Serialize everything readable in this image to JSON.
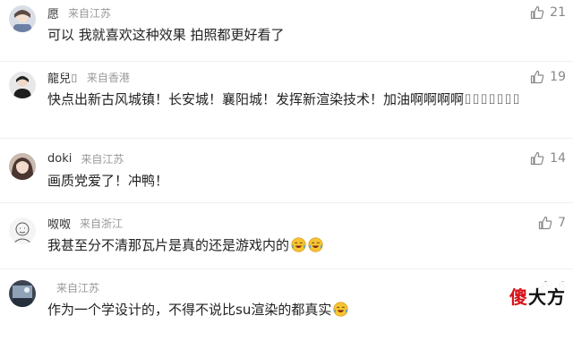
{
  "colors": {
    "text": "#222222",
    "username": "#333333",
    "meta": "#999999",
    "likes": "#888888",
    "watermark_red": "#d8131a"
  },
  "comments": [
    {
      "username": "愿",
      "location": "来自江苏",
      "likes": "21",
      "text": "可以 我就喜欢这种效果 拍照都更好看了",
      "avatar_icon": "avatar-anime-icon"
    },
    {
      "username": "龍兒⌷",
      "location": "来自香港",
      "likes": "19",
      "text": "快点出新古风城镇！长安城！襄阳城！发挥新渲染技术！加油啊啊啊啊⌷⌷⌷⌷⌷⌷⌷",
      "avatar_icon": "avatar-portrait-icon"
    },
    {
      "username": "doki",
      "location": "来自江苏",
      "likes": "14",
      "text": "画质党爱了！冲鸭！",
      "avatar_icon": "avatar-girl-icon"
    },
    {
      "username": "呶呶",
      "location": "来自浙江",
      "likes": "7",
      "text": "我甚至分不清那瓦片是真的还是游戏内的",
      "avatar_icon": "avatar-sketch-icon",
      "emojis": [
        "laugh-cry-emoji",
        "laugh-cry-emoji"
      ]
    },
    {
      "username": "",
      "location": "来自江苏",
      "likes": "6",
      "text": "作为一个学设计的，不得不说比su渲染的都真实",
      "avatar_icon": "avatar-dark-icon",
      "emojis": [
        "laugh-cry-emoji"
      ]
    }
  ],
  "watermark": {
    "part1": "傻",
    "part2": "大方"
  }
}
